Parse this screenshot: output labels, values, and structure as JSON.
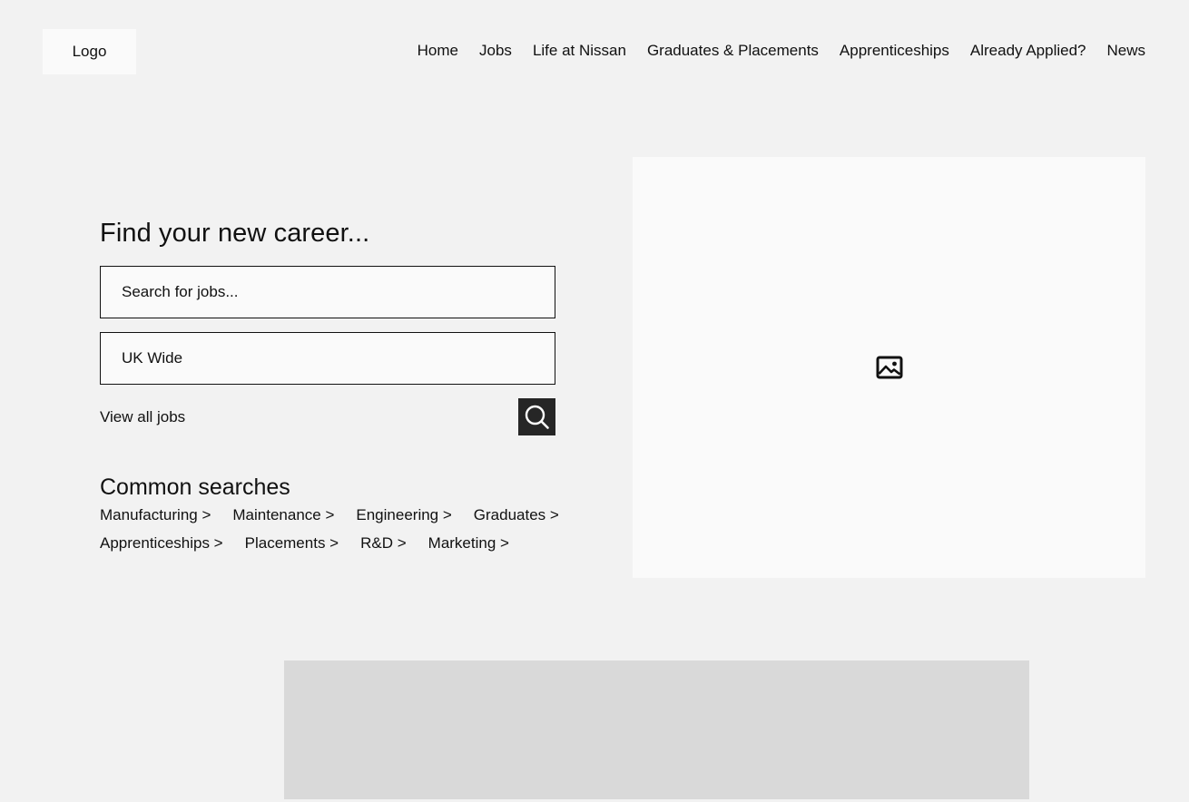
{
  "header": {
    "logo_label": "Logo",
    "nav": [
      {
        "label": "Home"
      },
      {
        "label": "Jobs"
      },
      {
        "label": "Life at Nissan"
      },
      {
        "label": "Graduates & Placements"
      },
      {
        "label": "Apprenticeships"
      },
      {
        "label": "Already Applied?"
      },
      {
        "label": "News"
      }
    ]
  },
  "search": {
    "title": "Find your new career...",
    "keyword_placeholder": "Search for jobs...",
    "location_value": "UK Wide",
    "view_all_label": "View all jobs",
    "button_icon": "search-icon"
  },
  "common_searches": {
    "title": "Common searches",
    "links": [
      {
        "label": "Manufacturing >"
      },
      {
        "label": "Maintenance >"
      },
      {
        "label": "Engineering >"
      },
      {
        "label": "Graduates >"
      },
      {
        "label": "Apprenticeships >"
      },
      {
        "label": "Placements >"
      },
      {
        "label": "R&D >"
      },
      {
        "label": "Marketing >"
      }
    ]
  },
  "hero_image": {
    "icon": "image-icon"
  },
  "colors": {
    "page_background": "#f2f2f2",
    "placeholder_light": "#fafafa",
    "placeholder_grey": "#d9d9d9",
    "button_dark": "#262626",
    "text": "#111111"
  }
}
